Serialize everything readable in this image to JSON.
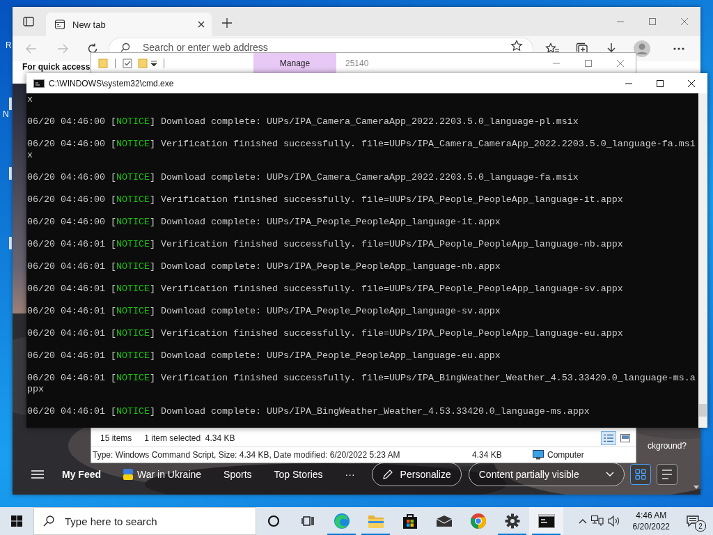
{
  "desktop": {
    "icon_labels": [
      "R",
      "N"
    ]
  },
  "browser": {
    "tabs": [
      {
        "label": "New tab",
        "selected": true
      }
    ],
    "address": {
      "placeholder": "Search or enter web address"
    },
    "page_text": "For quick access",
    "feed": {
      "corner_text": "ckground?",
      "nav": [
        {
          "label": "My Feed",
          "kind": "text",
          "selected": true
        },
        {
          "label": "War in Ukraine",
          "kind": "flag",
          "selected": false
        },
        {
          "label": "Sports",
          "kind": "text",
          "selected": false
        },
        {
          "label": "Top Stories",
          "kind": "text",
          "selected": false
        },
        {
          "label": "···",
          "kind": "text",
          "selected": false
        }
      ],
      "personalize": "Personalize",
      "visibility": "Content partially visible",
      "layouts": [
        {
          "kind": "grid",
          "selected": true
        },
        {
          "kind": "list",
          "selected": false
        }
      ]
    }
  },
  "explorer": {
    "ribbon_tab": "Manage",
    "title": "25140",
    "status": {
      "count": "15 items",
      "selection": "1 item selected  4.34 KB"
    },
    "views": [
      {
        "kind": "details",
        "selected": true
      },
      {
        "kind": "tiles",
        "selected": false
      }
    ],
    "details": {
      "info": "Type: Windows Command Script, Size: 4.34 KB, Date modified: 6/20/2022 5:23 AM",
      "size": "4.34 KB",
      "location": "Computer"
    }
  },
  "console": {
    "title": "C:\\WINDOWS\\system32\\cmd.exe",
    "continuation": "x",
    "entries": [
      {
        "prefix": "06/20 04:46:00 [",
        "tag": "NOTICE",
        "suffix": "] Download complete: UUPs/IPA_Camera_CameraApp_2022.2203.5.0_language-pl.msix"
      },
      {
        "prefix": "06/20 04:46:00 [",
        "tag": "NOTICE",
        "suffix": "] Verification finished successfully. file=UUPs/IPA_Camera_CameraApp_2022.2203.5.0_language-fa.msix"
      },
      {
        "prefix": "06/20 04:46:00 [",
        "tag": "NOTICE",
        "suffix": "] Download complete: UUPs/IPA_Camera_CameraApp_2022.2203.5.0_language-fa.msix"
      },
      {
        "prefix": "06/20 04:46:00 [",
        "tag": "NOTICE",
        "suffix": "] Verification finished successfully. file=UUPs/IPA_People_PeopleApp_language-it.appx"
      },
      {
        "prefix": "06/20 04:46:00 [",
        "tag": "NOTICE",
        "suffix": "] Download complete: UUPs/IPA_People_PeopleApp_language-it.appx"
      },
      {
        "prefix": "06/20 04:46:01 [",
        "tag": "NOTICE",
        "suffix": "] Verification finished successfully. file=UUPs/IPA_People_PeopleApp_language-nb.appx"
      },
      {
        "prefix": "06/20 04:46:01 [",
        "tag": "NOTICE",
        "suffix": "] Download complete: UUPs/IPA_People_PeopleApp_language-nb.appx"
      },
      {
        "prefix": "06/20 04:46:01 [",
        "tag": "NOTICE",
        "suffix": "] Verification finished successfully. file=UUPs/IPA_People_PeopleApp_language-sv.appx"
      },
      {
        "prefix": "06/20 04:46:01 [",
        "tag": "NOTICE",
        "suffix": "] Download complete: UUPs/IPA_People_PeopleApp_language-sv.appx"
      },
      {
        "prefix": "06/20 04:46:01 [",
        "tag": "NOTICE",
        "suffix": "] Verification finished successfully. file=UUPs/IPA_People_PeopleApp_language-eu.appx"
      },
      {
        "prefix": "06/20 04:46:01 [",
        "tag": "NOTICE",
        "suffix": "] Download complete: UUPs/IPA_People_PeopleApp_language-eu.appx"
      },
      {
        "prefix": "06/20 04:46:01 [",
        "tag": "NOTICE",
        "suffix": "] Verification finished successfully. file=UUPs/IPA_BingWeather_Weather_4.53.33420.0_language-ms.appx"
      },
      {
        "prefix": "06/20 04:46:01 [",
        "tag": "NOTICE",
        "suffix": "] Download complete: UUPs/IPA_BingWeather_Weather_4.53.33420.0_language-ms.appx"
      }
    ]
  },
  "taskbar": {
    "search": {
      "placeholder": "Type here to search"
    },
    "apps": [
      {
        "kind": "cortana",
        "running": false,
        "active": false
      },
      {
        "kind": "taskview",
        "running": false,
        "active": false
      },
      {
        "kind": "edge",
        "running": true,
        "active": false
      },
      {
        "kind": "folder",
        "running": true,
        "active": false
      },
      {
        "kind": "store",
        "running": false,
        "active": false
      },
      {
        "kind": "mail",
        "running": false,
        "active": false
      },
      {
        "kind": "chrome",
        "running": false,
        "active": false
      },
      {
        "kind": "settings",
        "running": true,
        "active": false
      },
      {
        "kind": "terminal",
        "running": true,
        "active": true
      }
    ],
    "clock": {
      "time": "4:46 AM",
      "date": "6/20/2022"
    },
    "notifications": "2"
  }
}
